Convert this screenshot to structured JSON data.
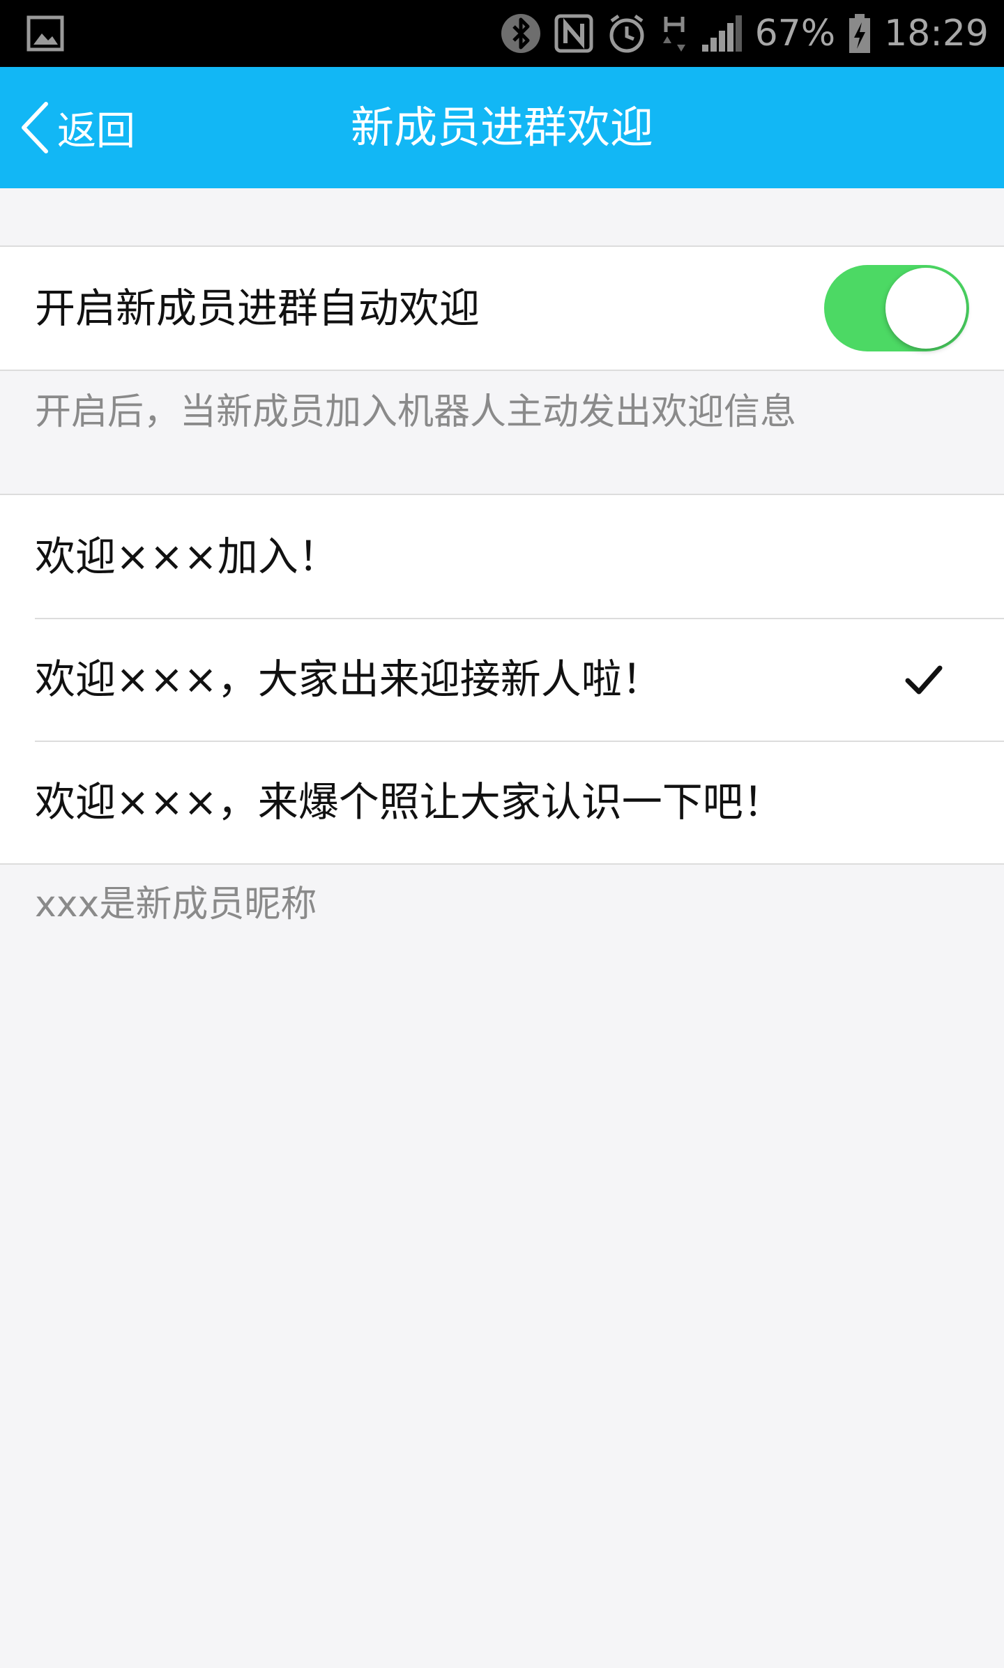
{
  "status_bar": {
    "battery": "67%",
    "time": "18:29",
    "icons": [
      "gallery-icon",
      "bluetooth-icon",
      "nfc-icon",
      "alarm-icon",
      "hplus-data-icon",
      "signal-icon",
      "battery-charging-icon"
    ]
  },
  "header": {
    "back_label": "返回",
    "title": "新成员进群欢迎",
    "color": "#12b7f5"
  },
  "auto_welcome": {
    "label": "开启新成员进群自动欢迎",
    "enabled": true,
    "hint": "开启后，当新成员加入机器人主动发出欢迎信息",
    "toggle_color": "#4cd964"
  },
  "messages": {
    "options": [
      {
        "label": "欢迎×××加入！",
        "selected": false
      },
      {
        "label": "欢迎×××，大家出来迎接新人啦！",
        "selected": true
      },
      {
        "label": "欢迎×××，来爆个照让大家认识一下吧！",
        "selected": false
      }
    ],
    "hint": "xxx是新成员昵称"
  }
}
